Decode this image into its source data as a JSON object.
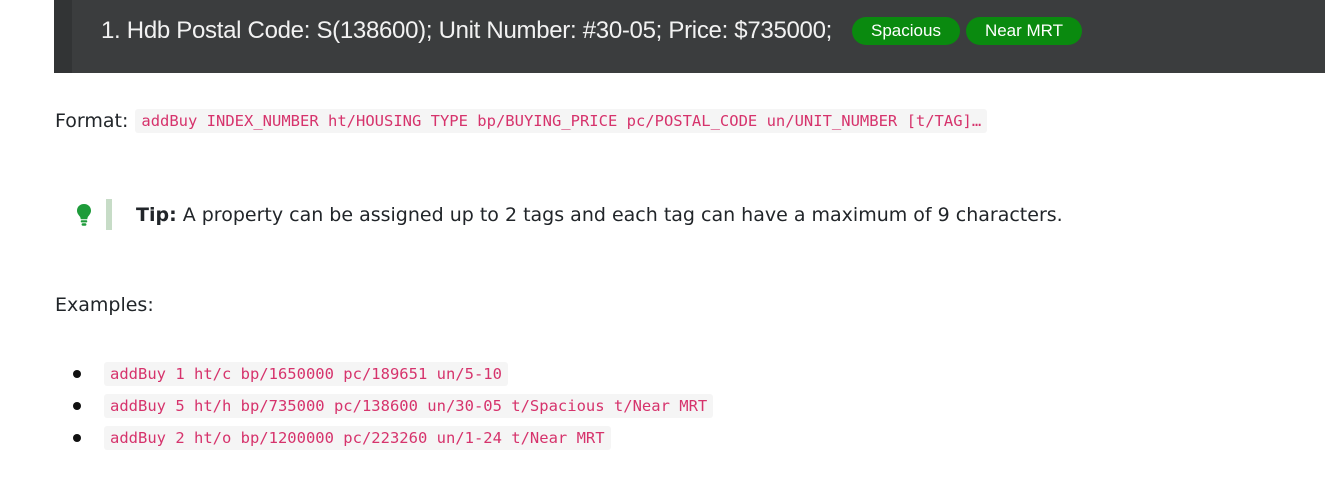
{
  "header": {
    "listing": "1. Hdb Postal Code: S(138600);  Unit Number: #30-05;  Price: $735000;",
    "tags": [
      "Spacious",
      "Near MRT"
    ]
  },
  "format": {
    "label": "Format:",
    "command": "addBuy INDEX_NUMBER ht/HOUSING TYPE bp/BUYING_PRICE pc/POSTAL_CODE un/UNIT_NUMBER [t/TAG]…"
  },
  "tip": {
    "label": "Tip:",
    "text": " A property can be assigned up to 2 tags and each tag can have a maximum of 9 characters."
  },
  "examples": {
    "label": "Examples:",
    "items": [
      "addBuy 1 ht/c bp/1650000 pc/189651 un/5-10",
      "addBuy 5 ht/h bp/735000 pc/138600 un/30-05 t/Spacious t/Near MRT",
      "addBuy 2 ht/o bp/1200000 pc/223260 un/1-24 t/Near MRT"
    ]
  },
  "colors": {
    "header_bg": "#3b3d3e",
    "tag_bg": "#0a8a0f",
    "code_text": "#d6336c",
    "tip_icon": "#1e9b3a"
  }
}
